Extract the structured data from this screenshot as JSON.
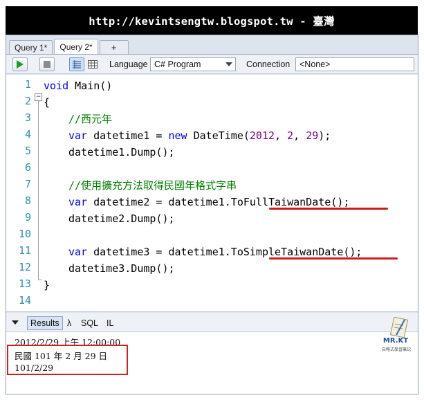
{
  "banner": {
    "text": "http://kevintsengtw.blogspot.tw - 臺灣"
  },
  "tabs": [
    {
      "label": "Query 1*"
    },
    {
      "label": "Query 2*"
    },
    {
      "label": "+"
    }
  ],
  "toolbar": {
    "language_label": "Language",
    "language_value": "C# Program",
    "connection_label": "Connection",
    "connection_value": "<None>"
  },
  "editor": {
    "line_numbers": [
      "1",
      "2",
      "3",
      "4",
      "5",
      "6",
      "7",
      "8",
      "9",
      "10",
      "11",
      "12",
      "13",
      "14"
    ],
    "lines": {
      "l1_kw": "void",
      "l1_rest": " Main()",
      "l2": "{",
      "l3_comment": "//西元年",
      "l4_var": "var",
      "l4_a": " datetime1 = ",
      "l4_new": "new",
      "l4_b": " DateTime(",
      "l4_n1": "2012",
      "l4_c1": ", ",
      "l4_n2": "2",
      "l4_c2": ", ",
      "l4_n3": "29",
      "l4_end": ");",
      "l5": "datetime1.Dump();",
      "l7_comment": "//使用擴充方法取得民國年格式字串",
      "l8_var": "var",
      "l8_rest": " datetime2 = datetime1.ToFullTaiwanDate();",
      "l9": "datetime2.Dump();",
      "l11_var": "var",
      "l11_rest": " datetime3 = datetime1.ToSimpleTaiwanDate();",
      "l12": "datetime3.Dump();",
      "l13": "}"
    }
  },
  "results_tabs": {
    "results": "Results",
    "lambda": "λ",
    "sql": "SQL",
    "il": "IL"
  },
  "results": [
    "2012/2/29 上午 12:00:00",
    "民國 101 年 2 月 29 日",
    "101/2/29"
  ],
  "logo": {
    "text": "MR.KT",
    "subtitle": "自略式學習筆記"
  },
  "colors": {
    "keyword": "#0000ff",
    "comment": "#008000",
    "number": "#800080",
    "line_number": "#2b91af",
    "highlight": "#d11a1a"
  }
}
